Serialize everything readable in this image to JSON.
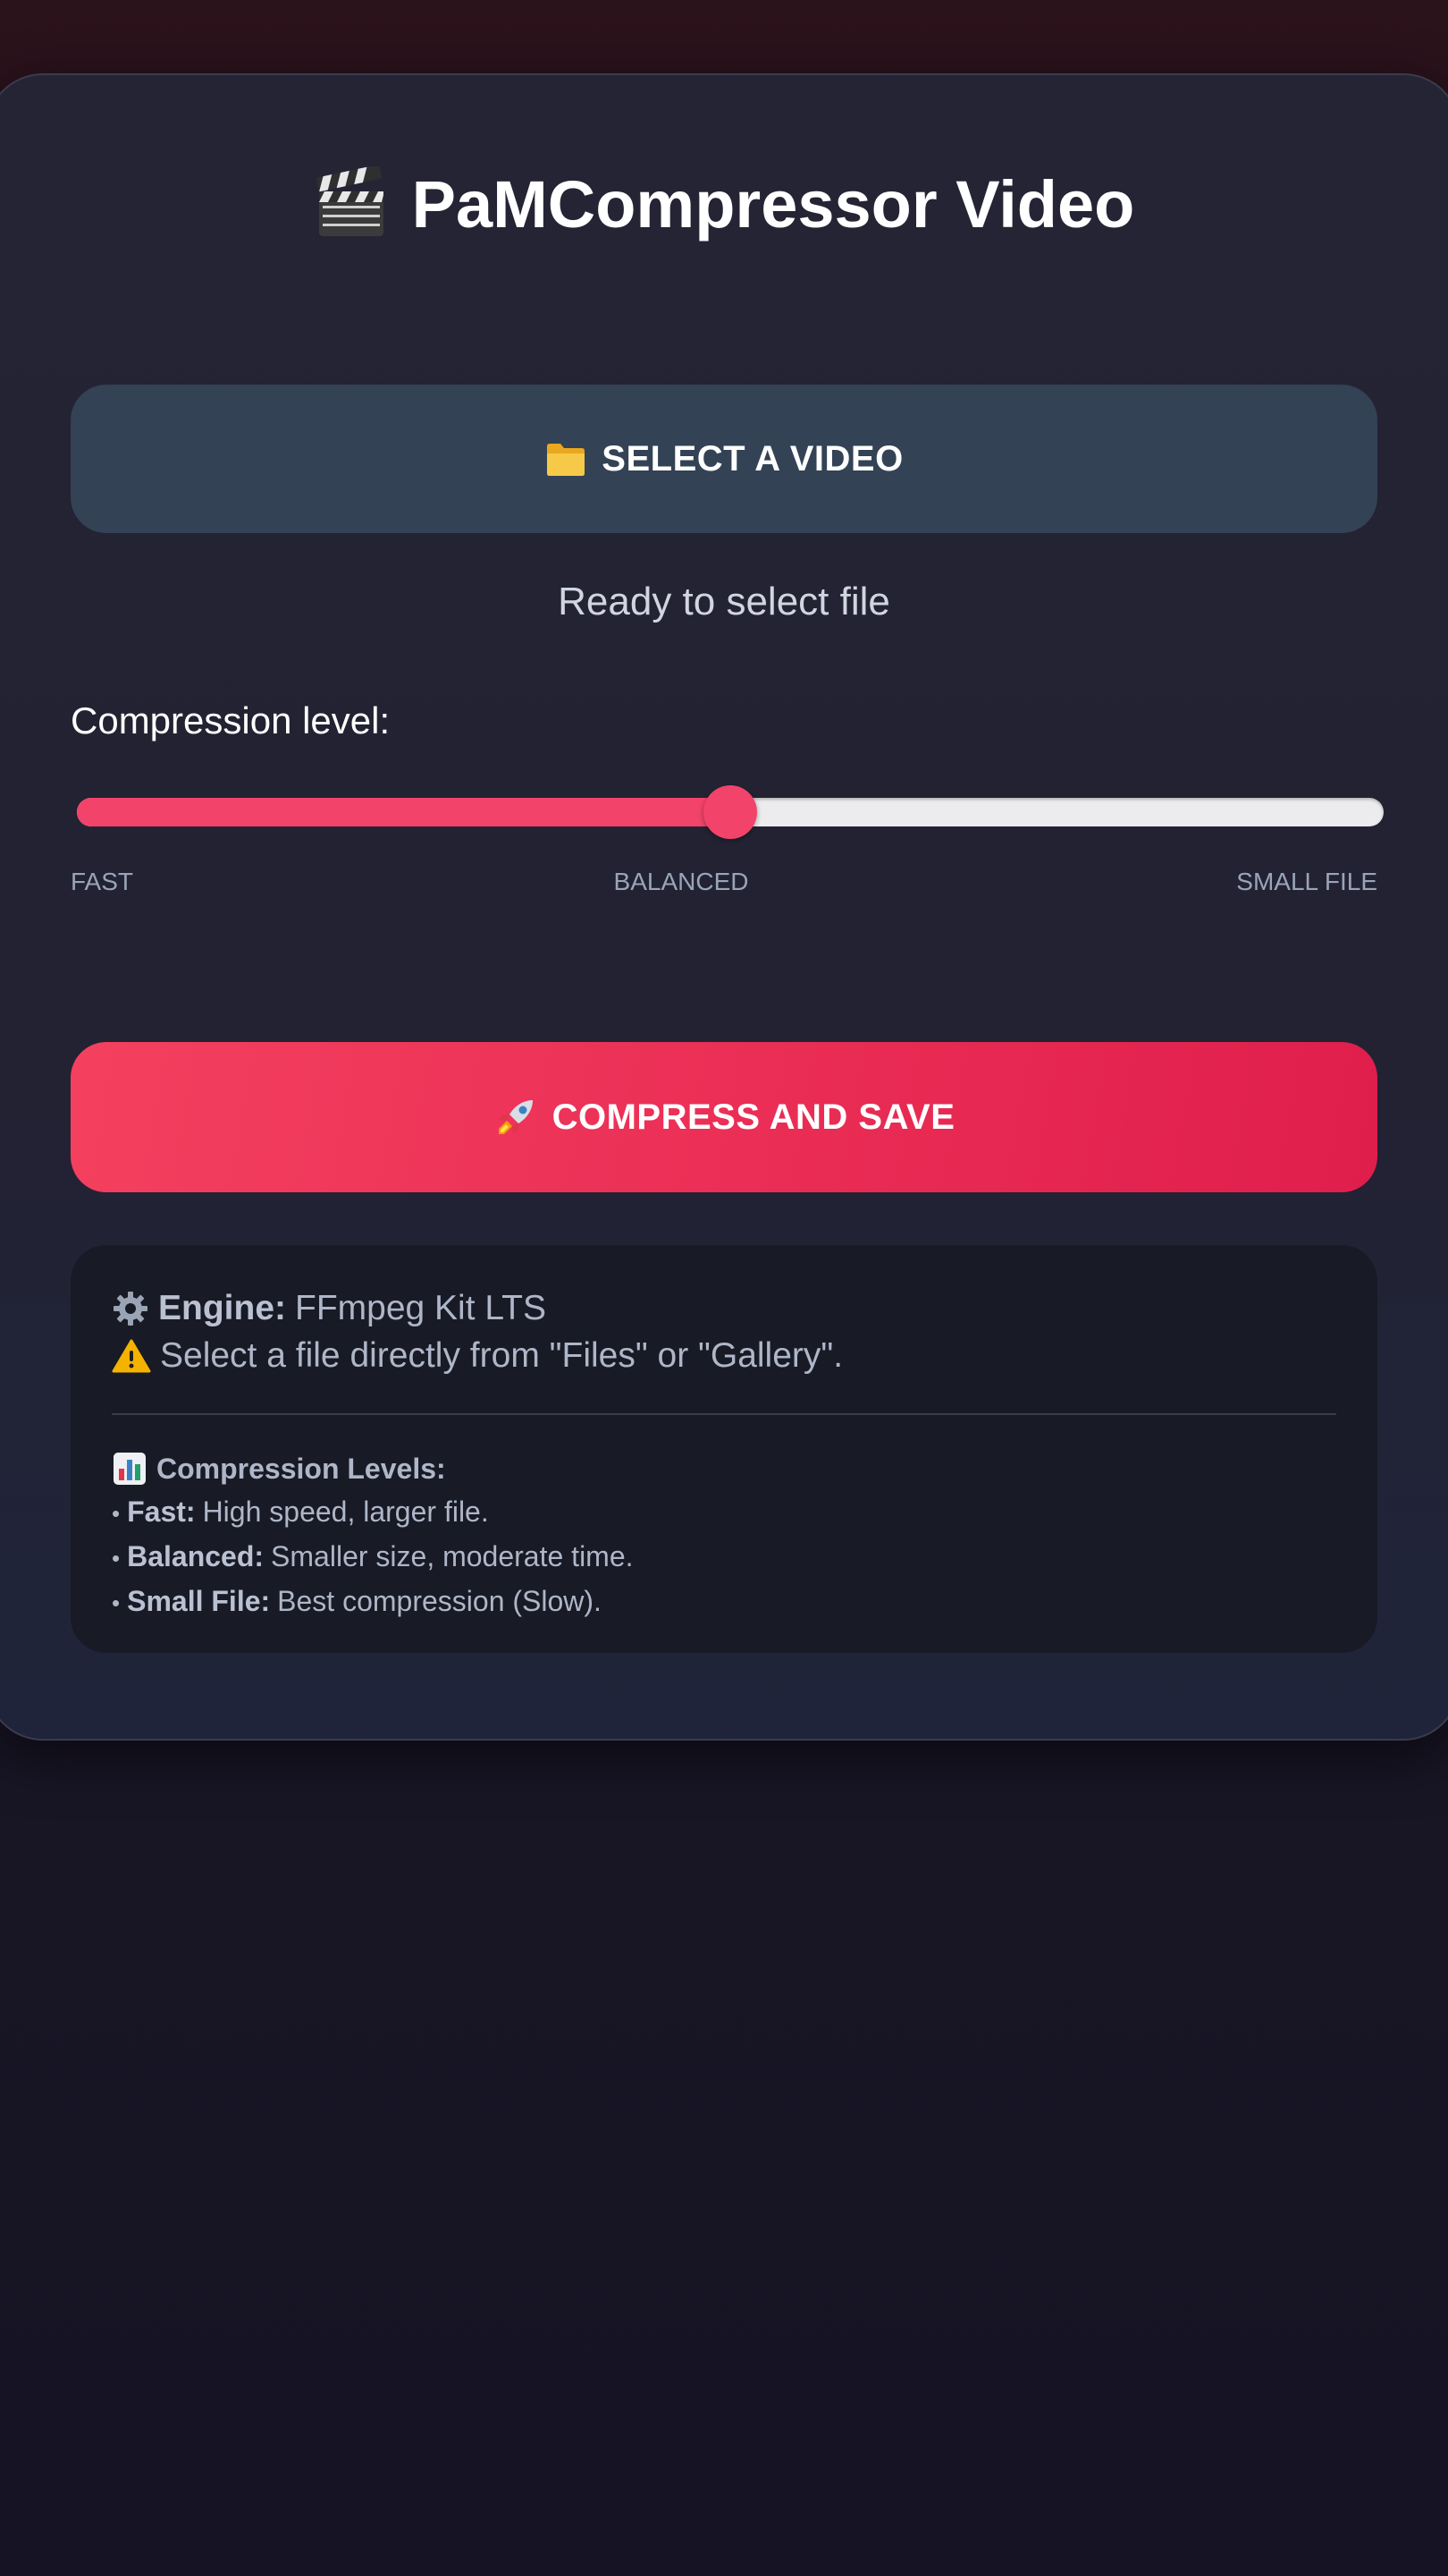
{
  "app": {
    "title": "PaMCompressor Video",
    "title_icon": "clapperboard-icon"
  },
  "select_button": {
    "icon": "folder-icon",
    "label": "SELECT A VIDEO"
  },
  "status": {
    "text": "Ready to select file"
  },
  "compression": {
    "label": "Compression level:",
    "value": 0.5,
    "ticks": [
      "FAST",
      "BALANCED",
      "SMALL FILE"
    ]
  },
  "compress_button": {
    "icon": "rocket-icon",
    "label": "COMPRESS AND SAVE"
  },
  "info": {
    "engine_label": "Engine:",
    "engine_value": "FFmpeg Kit LTS",
    "warning_text": "Select a file directly from \"Files\" or \"Gallery\".",
    "levels_title": "Compression Levels:",
    "levels": [
      {
        "bullet": "•",
        "name": "Fast:",
        "description": "High speed, larger file."
      },
      {
        "bullet": "•",
        "name": "Balanced:",
        "description": "Smaller size, moderate time."
      },
      {
        "bullet": "•",
        "name": "Small File:",
        "description": "Best compression (Slow)."
      }
    ]
  },
  "colors": {
    "accent": "#f2436a",
    "select_button_bg": "#334255",
    "card_bg": "#232333",
    "info_bg": "#181a25"
  }
}
